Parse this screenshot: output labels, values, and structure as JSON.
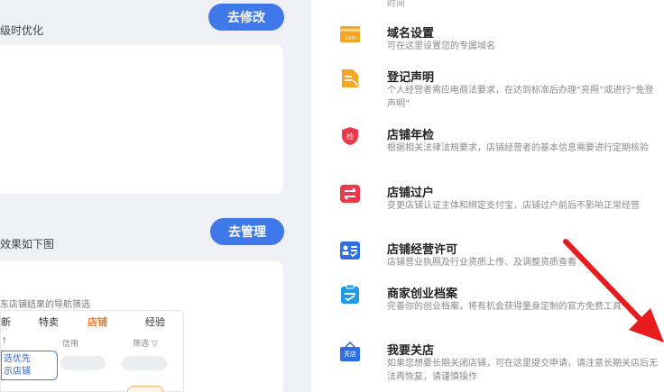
{
  "left": {
    "edit_button": "去修改",
    "section1_title": "级时优化",
    "manage_button": "去管理",
    "section2_title": "效果如下图",
    "hint_text": "东店铺结果的导航筛选",
    "nav_tabs": [
      "新",
      "特卖",
      "店铺",
      "经验"
    ],
    "active_tab": 2,
    "nav_sub": [
      "↑",
      "信用",
      "筛选 ▽"
    ],
    "tooltip": [
      "选优先",
      "示店铺"
    ]
  },
  "right": {
    "time_text": "时间",
    "items": [
      {
        "icon": "domain-com-icon",
        "color": "#f6a623",
        "title": "域名设置",
        "desc": "可在这里设置您的专属域名"
      },
      {
        "icon": "document-edit-icon",
        "color": "#f6a623",
        "title": "登记声明",
        "desc": "个人经营者需应电商法要求，在达到标准后办理“亮照”或进行“免登声明”"
      },
      {
        "icon": "shield-inspection-icon",
        "color": "#e9394a",
        "title": "店铺年检",
        "desc": "根据相关法律法规要求，店铺经营者的基本信息需要进行定期核验"
      },
      {
        "icon": "transfer-icon",
        "color": "#e9394a",
        "title": "店铺过户",
        "desc": "变更店铺认证主体和绑定支付宝，店铺过户前后不影响正常经营"
      },
      {
        "icon": "license-icon",
        "color": "#2f6fe0",
        "title": "店铺经营许可",
        "desc": "店铺营业执照及行业资质上传、及调整资质查看"
      },
      {
        "icon": "archive-icon",
        "color": "#1f9be6",
        "title": "商家创业档案",
        "desc": "完善你的创业档案，将有机会获得量身定制的官方免费工具"
      },
      {
        "icon": "close-shop-icon",
        "color": "#2f6fe0",
        "icon_label": "关店",
        "title": "我要关店",
        "desc": "如果您想要长期关闭店铺，可在这里提交申请，请注意长期关店后无法再恢复，请谨慎操作"
      }
    ]
  },
  "colors": {
    "accent_blue": "#3f78e8",
    "active_orange": "#f07a2d",
    "arrow_red": "#e81c1c"
  }
}
